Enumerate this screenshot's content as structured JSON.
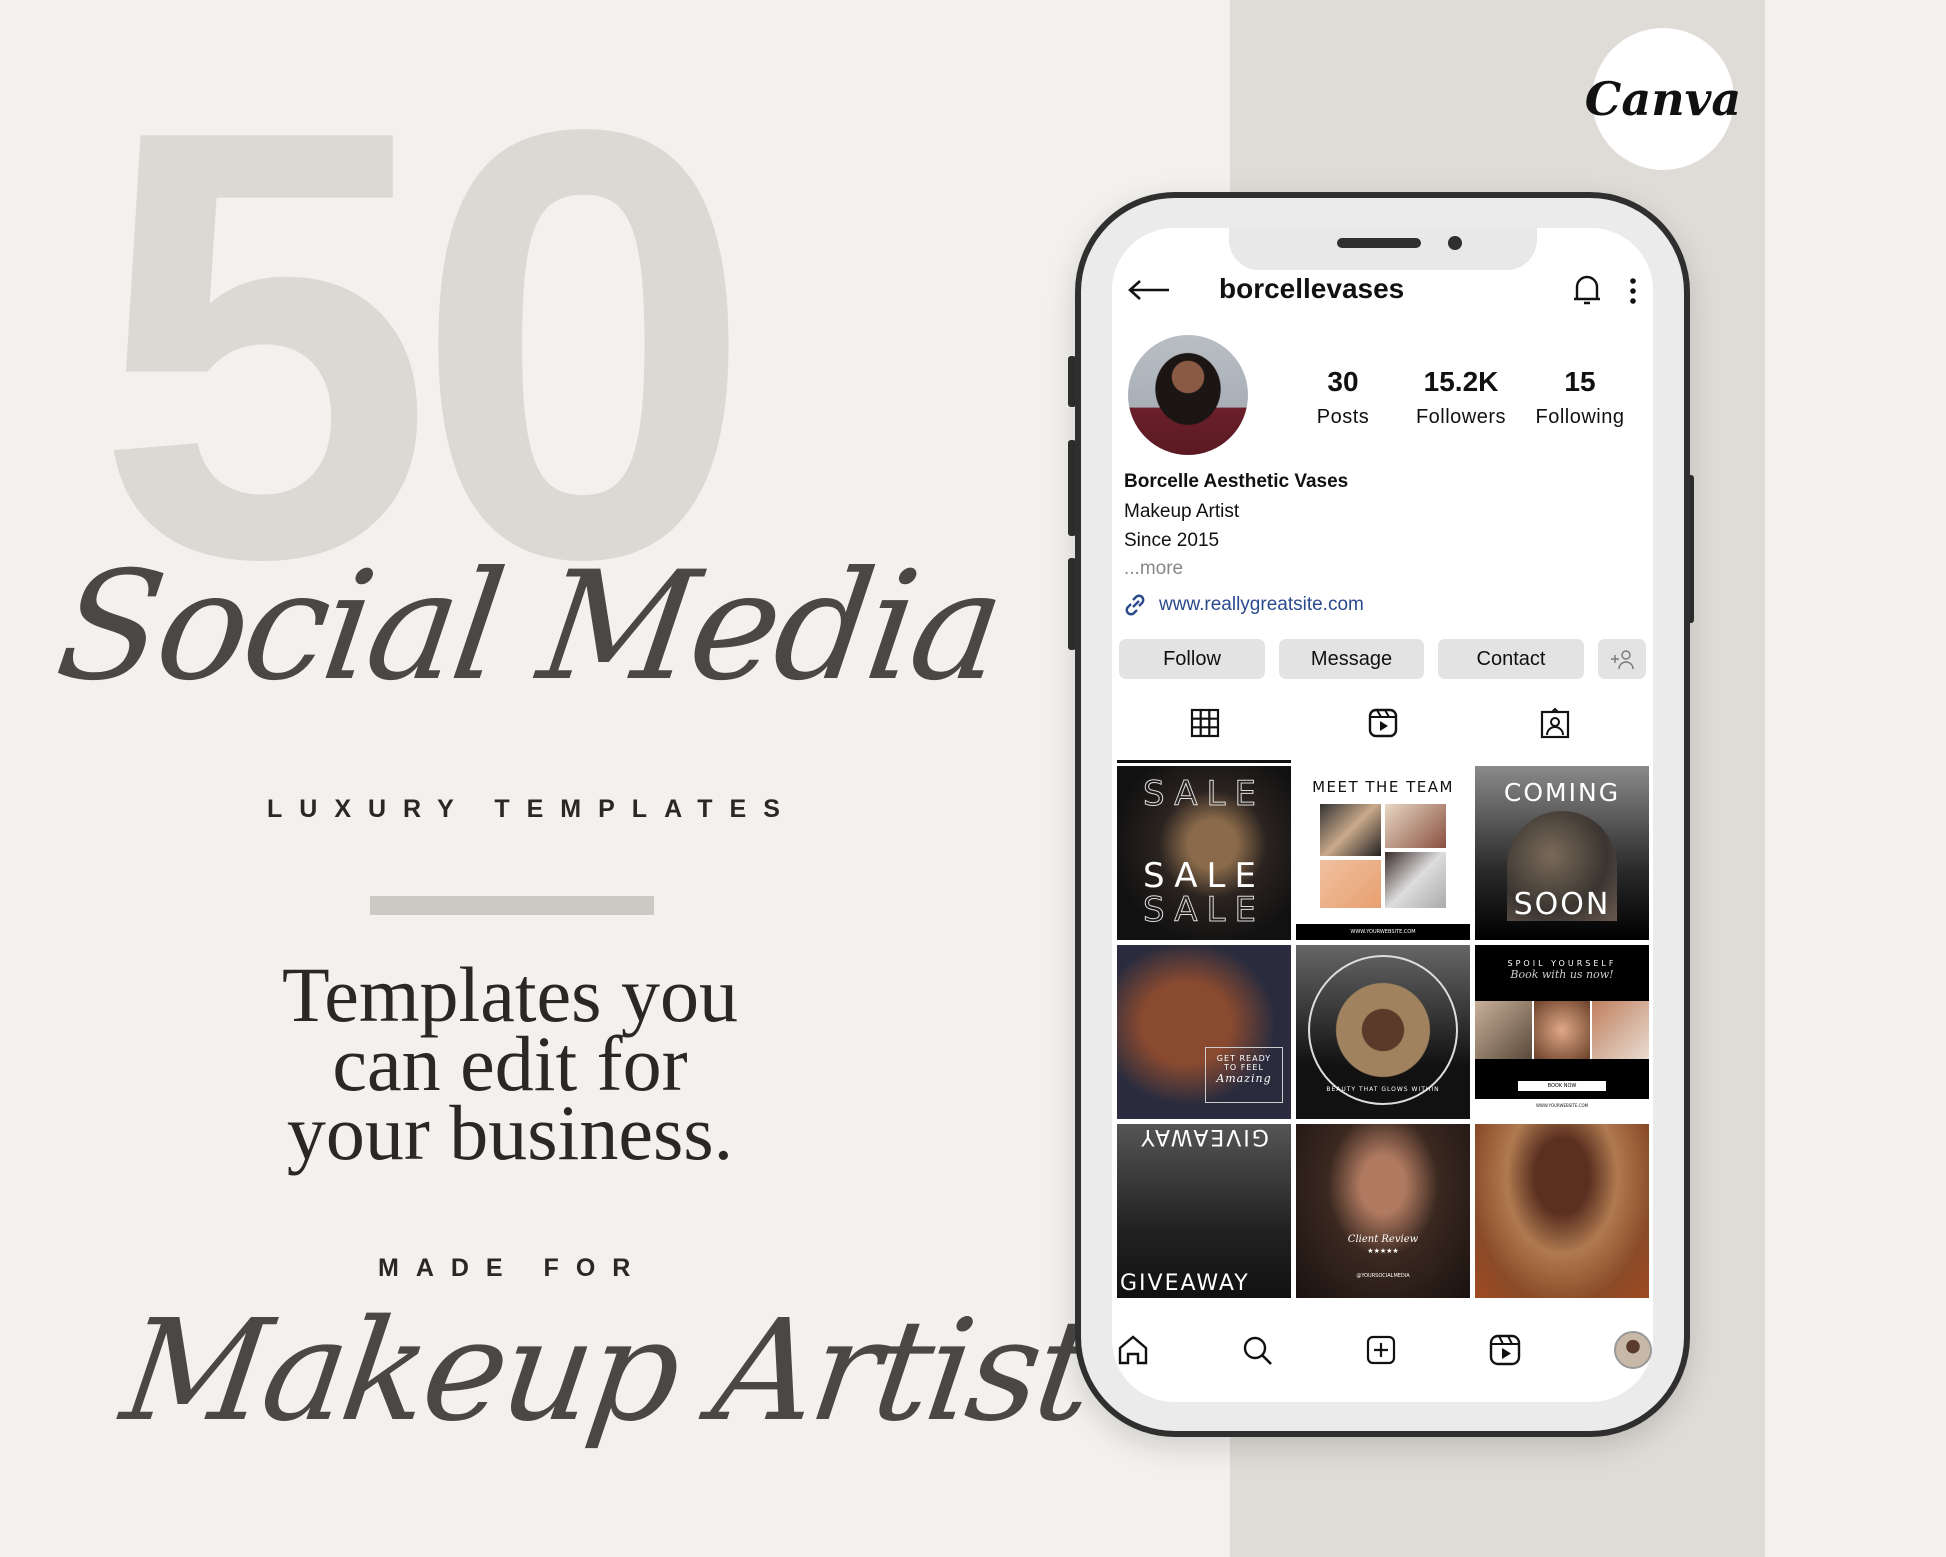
{
  "promo": {
    "number": "50",
    "title_script": "Social Media",
    "subtitle": "LUXURY TEMPLATES",
    "tagline": [
      "Templates you",
      "can edit for",
      "your business."
    ],
    "made_for": "MADE FOR",
    "audience_script": "Makeup Artist",
    "logo": "Canva"
  },
  "colors": {
    "background": "#f3f1ed",
    "band": "#dfdbd6",
    "link": "#2b4a8c",
    "phone_frame": "#2f2f2f"
  },
  "profile": {
    "username": "borcellevases",
    "stats": [
      {
        "value": "30",
        "label": "Posts"
      },
      {
        "value": "15.2K",
        "label": "Followers"
      },
      {
        "value": "15",
        "label": "Following"
      }
    ],
    "name": "Borcelle Aesthetic Vases",
    "bio": [
      "Makeup Artist",
      "Since 2015"
    ],
    "more": "...more",
    "link": "www.reallygreatsite.com",
    "buttons": {
      "follow": "Follow",
      "message": "Message",
      "contact": "Contact"
    }
  },
  "header_icons": [
    "back-arrow-icon",
    "bell-icon",
    "more-vertical-icon"
  ],
  "tabs": [
    "grid-icon",
    "reels-icon",
    "tagged-icon"
  ],
  "posts": {
    "sale": "SALE",
    "team": "MEET THE TEAM",
    "website": "WWW.YOURWEBSITE.COM",
    "coming": "COMING",
    "soon": "SOON",
    "ready": "GET READY",
    "feel": "TO FEEL",
    "amazing": "Amazing",
    "glow": "BEAUTY THAT GLOWS WITHIN",
    "spoil": "SPOIL YOURSELF",
    "book_script": "Book with us now!",
    "book_now": "BOOK NOW",
    "giveaway": "GIVEAWAY",
    "review": "Client Review",
    "stars": "★★★★★",
    "social": "@YOURSOCIALMEDIA"
  },
  "bottom_nav": [
    "home-icon",
    "search-icon",
    "new-post-icon",
    "reels-icon",
    "profile-icon"
  ]
}
